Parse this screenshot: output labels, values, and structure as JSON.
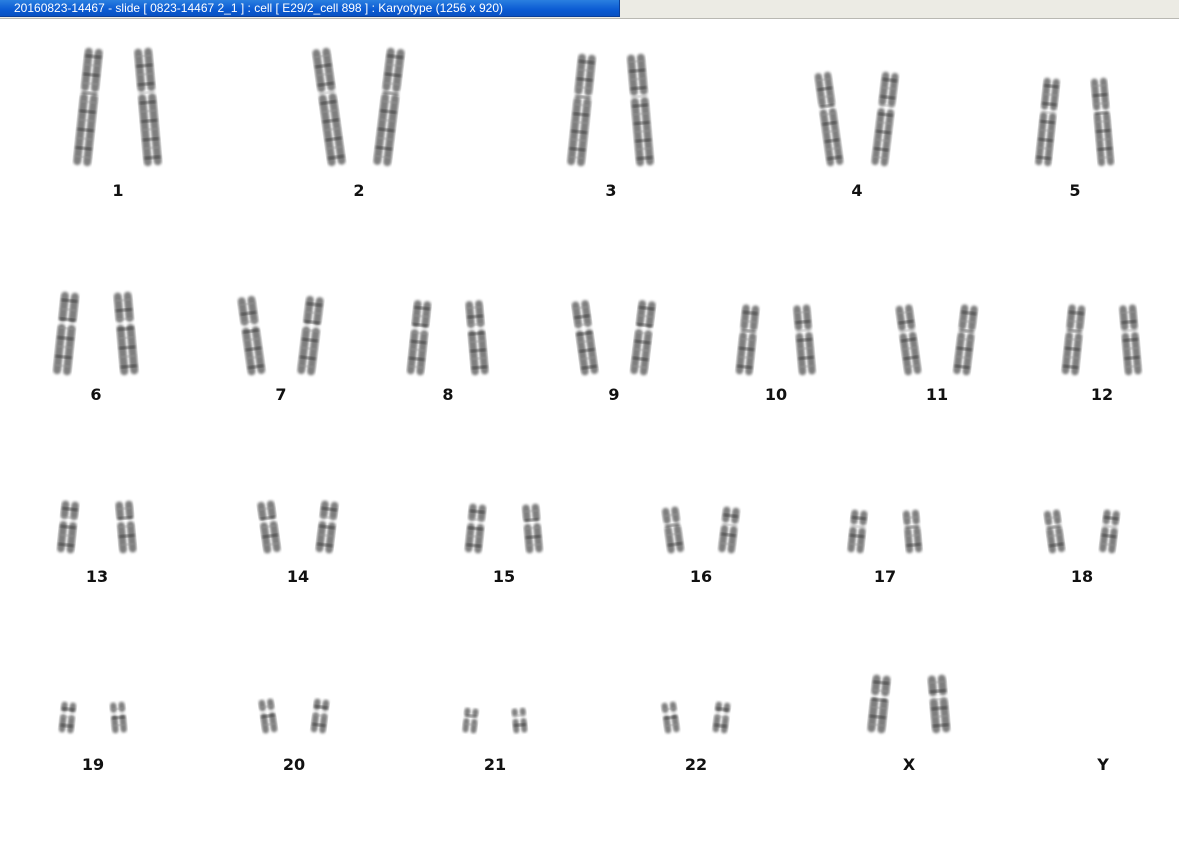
{
  "window": {
    "title": "20160823-14467 - slide [ 0823-14467 2_1 ] : cell [ E29/2_cell 898 ] : Karyotype  (1256 x 920)"
  },
  "colors": {
    "title_bar": "#0b5bd3",
    "title_text": "#ffffff",
    "background": "#ffffff",
    "chromosome": "#5a5a5a",
    "label": "#111111"
  },
  "karyotype": {
    "rows": [
      {
        "pairs": [
          {
            "label": "1",
            "chromatids": 2
          },
          {
            "label": "2",
            "chromatids": 2
          },
          {
            "label": "3",
            "chromatids": 2
          },
          {
            "label": "4",
            "chromatids": 2
          },
          {
            "label": "5",
            "chromatids": 2
          }
        ]
      },
      {
        "pairs": [
          {
            "label": "6",
            "chromatids": 2
          },
          {
            "label": "7",
            "chromatids": 2
          },
          {
            "label": "8",
            "chromatids": 2
          },
          {
            "label": "9",
            "chromatids": 2
          },
          {
            "label": "10",
            "chromatids": 2
          },
          {
            "label": "11",
            "chromatids": 2
          },
          {
            "label": "12",
            "chromatids": 2
          }
        ]
      },
      {
        "pairs": [
          {
            "label": "13",
            "chromatids": 2
          },
          {
            "label": "14",
            "chromatids": 2
          },
          {
            "label": "15",
            "chromatids": 2
          },
          {
            "label": "16",
            "chromatids": 2
          },
          {
            "label": "17",
            "chromatids": 2
          },
          {
            "label": "18",
            "chromatids": 2
          }
        ]
      },
      {
        "pairs": [
          {
            "label": "19",
            "chromatids": 2
          },
          {
            "label": "20",
            "chromatids": 2
          },
          {
            "label": "21",
            "chromatids": 2
          },
          {
            "label": "22",
            "chromatids": 2
          },
          {
            "label": "X",
            "chromatids": 2
          },
          {
            "label": "Y",
            "chromatids": 0
          }
        ]
      }
    ]
  }
}
